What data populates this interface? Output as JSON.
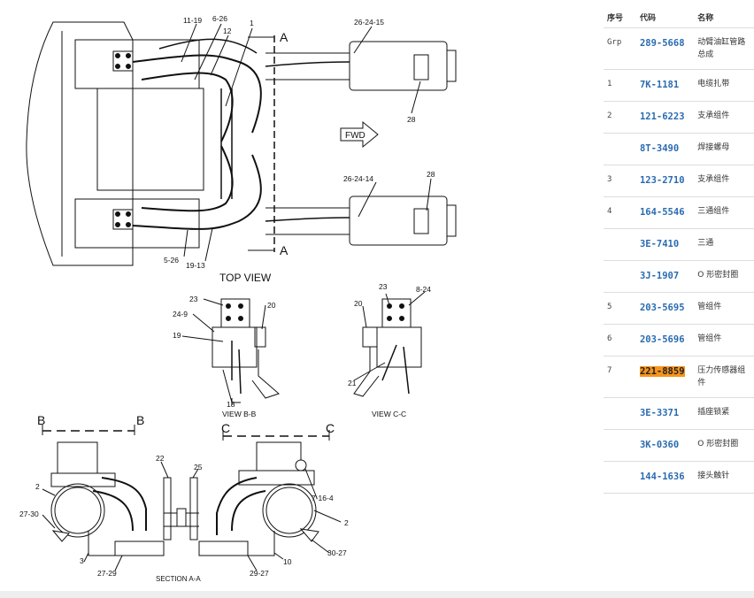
{
  "diagram": {
    "top_labels": [
      "11-19",
      "6-26",
      "12",
      "1",
      "26-24-15",
      "28",
      "26-24-14",
      "28",
      "5-26",
      "19-13",
      "A",
      "A",
      "FWD"
    ],
    "view_labels": {
      "top_view": "TOP VIEW",
      "view_bb": "VIEW B-B",
      "view_cc": "VIEW C-C",
      "section_aa": "SECTION A-A"
    },
    "bb_labels": [
      "23",
      "24-9",
      "20",
      "19",
      "18"
    ],
    "cc_labels": [
      "23",
      "8-24",
      "20",
      "21"
    ],
    "section_labels": [
      "B",
      "B",
      "C",
      "C",
      "22",
      "25",
      "2",
      "27-30",
      "3",
      "27-29",
      "7-16-4",
      "2",
      "30-27",
      "10",
      "29-27"
    ]
  },
  "parts_table": {
    "top_cut_text": "                              ",
    "headers": {
      "seq": "序号",
      "code": "代码",
      "name": "名称"
    },
    "rows": [
      {
        "seq": "Grp",
        "code": "289-5668",
        "name": "动臂油缸管路总成",
        "highlight": false
      },
      {
        "seq": "1",
        "code": "7K-1181",
        "name": "电缆扎带",
        "highlight": false
      },
      {
        "seq": "2",
        "code": "121-6223",
        "name": "支承组件",
        "highlight": false
      },
      {
        "seq": "",
        "code": "8T-3490",
        "name": "焊接螺母",
        "highlight": false
      },
      {
        "seq": "3",
        "code": "123-2710",
        "name": "支承组件",
        "highlight": false
      },
      {
        "seq": "4",
        "code": "164-5546",
        "name": "三通组件",
        "highlight": false
      },
      {
        "seq": "",
        "code": "3E-7410",
        "name": "三通",
        "highlight": false
      },
      {
        "seq": "",
        "code": "3J-1907",
        "name": "O 形密封圈",
        "highlight": false
      },
      {
        "seq": "5",
        "code": "203-5695",
        "name": "管组件",
        "highlight": false
      },
      {
        "seq": "6",
        "code": "203-5696",
        "name": "管组件",
        "highlight": false
      },
      {
        "seq": "7",
        "code": "221-8859",
        "name": "压力传感器组件",
        "highlight": true
      },
      {
        "seq": "",
        "code": "3E-3371",
        "name": "插座锁紧",
        "highlight": false
      },
      {
        "seq": "",
        "code": "3K-0360",
        "name": "O 形密封圈",
        "highlight": false
      },
      {
        "seq": "",
        "code": "144-1636",
        "name": "接头触针",
        "highlight": false
      }
    ]
  }
}
